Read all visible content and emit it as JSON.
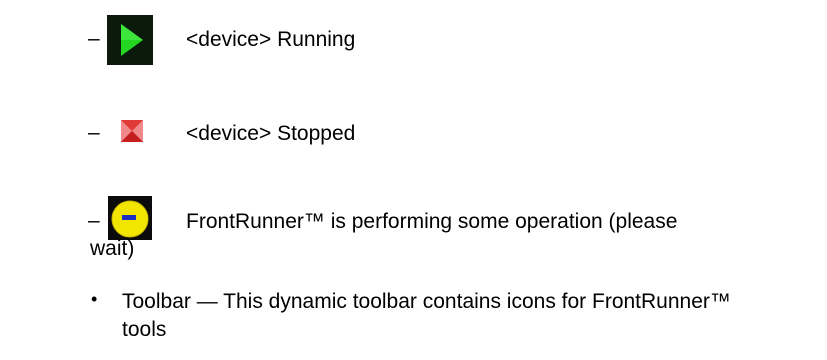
{
  "items": [
    {
      "dash": "–",
      "icon": "running-green-play-icon",
      "text": "<device> Running"
    },
    {
      "dash": "–",
      "icon": "stopped-red-icon",
      "text": "<device> Stopped"
    },
    {
      "dash": "–",
      "icon": "busy-yellow-circle-icon",
      "text_line1": "FrontRunner™ is performing some operation (please",
      "text_line2": "wait)"
    }
  ],
  "bullet": {
    "marker": "•",
    "text_line1": "Toolbar — This dynamic toolbar contains icons for FrontRunner™",
    "text_line2": "tools"
  },
  "colors": {
    "running_green": "#1fd11f",
    "stopped_red": "#e0302f",
    "busy_yellow": "#f2e600",
    "busy_blue": "#1c2fbf"
  }
}
